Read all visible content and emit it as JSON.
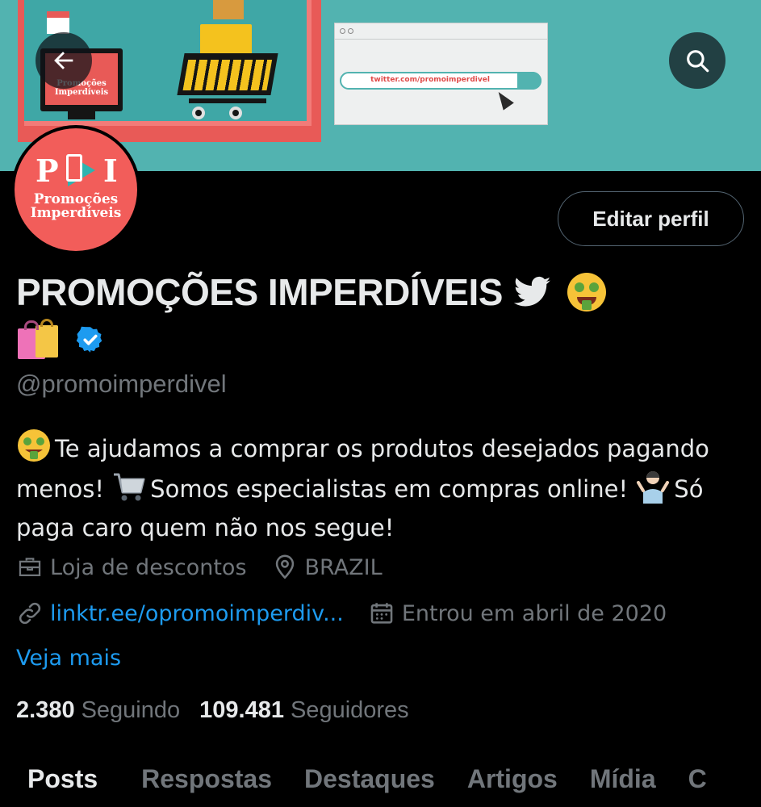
{
  "banner": {
    "monitor_text": "Promoções Imperdíveis",
    "browser_url": "twitter.com/promoimperdivel"
  },
  "avatar": {
    "letters": [
      "P",
      "I"
    ],
    "text": "Promoções Imperdíveis"
  },
  "header": {
    "edit_button": "Editar perfil"
  },
  "profile": {
    "display_name": "PROMOÇÕES IMPERDÍVEIS",
    "handle": "@promoimperdivel",
    "bio": {
      "part1": "Te ajudamos a comprar os produtos desejados pagando menos!",
      "part2": "Somos especialistas em compras online!",
      "part3": "Só paga caro quem não nos segue!"
    },
    "category": "Loja de descontos",
    "location": "BRAZIL",
    "website": "linktr.ee/opromoimperdiv...",
    "joined": "Entrou em abril de 2020",
    "see_more": "Veja mais"
  },
  "stats": {
    "following_count": "2.380",
    "following_label": "Seguindo",
    "followers_count": "109.481",
    "followers_label": "Seguidores"
  },
  "tabs": [
    "Posts",
    "Respostas",
    "Destaques",
    "Artigos",
    "Mídia",
    "C"
  ],
  "colors": {
    "background": "#000000",
    "text_primary": "#e7e9ea",
    "text_secondary": "#71767b",
    "link": "#1d9bf0",
    "banner": "#52b3b0",
    "avatar": "#f25d5a"
  },
  "icons": {
    "back": "arrow-left-icon",
    "search": "search-icon",
    "twitter_bird": "twitter-bird-icon",
    "money_face": "money-mouth-face-icon",
    "shopping_bags": "shopping-bags-icon",
    "verified": "verified-badge-icon",
    "category": "briefcase-icon",
    "location": "location-pin-icon",
    "link": "link-icon",
    "calendar": "calendar-icon"
  }
}
